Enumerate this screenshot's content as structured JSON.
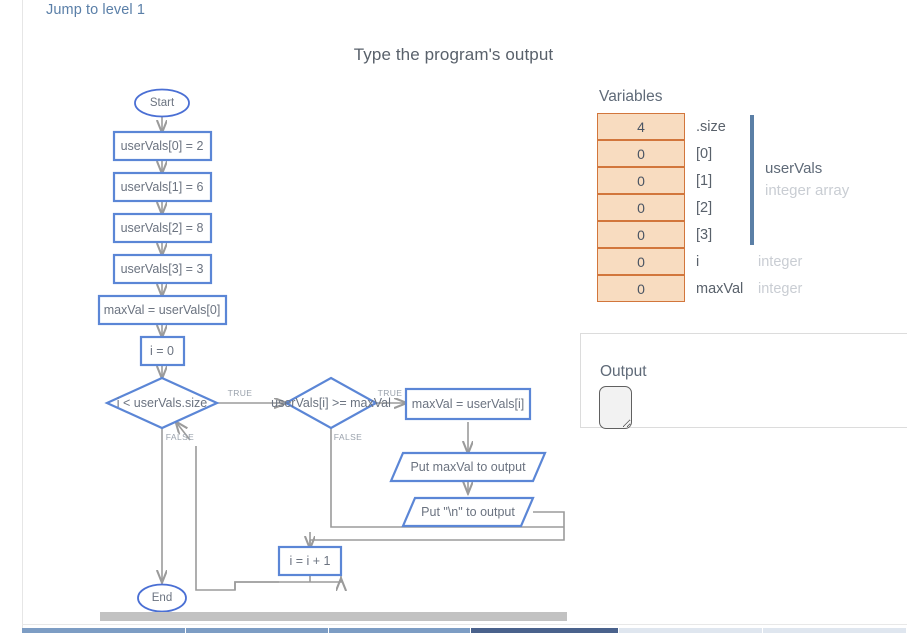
{
  "header": {
    "jump_link": "Jump to level 1",
    "title": "Type the program's output"
  },
  "flowchart": {
    "nodes": [
      {
        "id": "start",
        "type": "terminal",
        "label": "Start"
      },
      {
        "id": "a0",
        "type": "process",
        "label": "userVals[0] = 2"
      },
      {
        "id": "a1",
        "type": "process",
        "label": "userVals[1] = 6"
      },
      {
        "id": "a2",
        "type": "process",
        "label": "userVals[2] = 8"
      },
      {
        "id": "a3",
        "type": "process",
        "label": "userVals[3] = 3"
      },
      {
        "id": "initmax",
        "type": "process",
        "label": "maxVal = userVals[0]"
      },
      {
        "id": "initi",
        "type": "process",
        "label": "i = 0"
      },
      {
        "id": "cond1",
        "type": "decision",
        "label": "i < userVals.size"
      },
      {
        "id": "cond2",
        "type": "decision",
        "label": "userVals[i] >= maxVal"
      },
      {
        "id": "setmax",
        "type": "process",
        "label": "maxVal = userVals[i]"
      },
      {
        "id": "put1",
        "type": "io",
        "label": "Put maxVal to output"
      },
      {
        "id": "put2",
        "type": "io",
        "label": "Put \"\\n\" to output"
      },
      {
        "id": "incr",
        "type": "process",
        "label": "i = i + 1"
      },
      {
        "id": "end",
        "type": "terminal",
        "label": "End"
      }
    ],
    "branch_labels": {
      "cond1_true": "TRUE",
      "cond1_false": "FALSE",
      "cond2_true": "TRUE",
      "cond2_false": "FALSE"
    },
    "colors": {
      "node_border": "#5b86d6",
      "connector": "#9b9b9b",
      "text": "#6b7380"
    }
  },
  "variables": {
    "heading": "Variables",
    "rows": [
      {
        "value": "4",
        "name": ".size",
        "type": ""
      },
      {
        "value": "0",
        "name": "[0]",
        "type": ""
      },
      {
        "value": "0",
        "name": "[1]",
        "type": ""
      },
      {
        "value": "0",
        "name": "[2]",
        "type": ""
      },
      {
        "value": "0",
        "name": "[3]",
        "type": ""
      },
      {
        "value": "0",
        "name": "i",
        "type": "integer"
      },
      {
        "value": "0",
        "name": "maxVal",
        "type": "integer"
      }
    ],
    "array_group": {
      "name": "userVals",
      "type": "integer array"
    },
    "colors": {
      "cell_fill": "#f8dcc0",
      "cell_border": "#d2763c",
      "bracket": "#5b7fa6"
    }
  },
  "output": {
    "label": "Output",
    "value": "",
    "placeholder": ""
  },
  "progress": {
    "segments": [
      {
        "state": "done"
      },
      {
        "state": "done"
      },
      {
        "state": "done"
      },
      {
        "state": "current"
      },
      {
        "state": "pending"
      },
      {
        "state": "pending"
      }
    ]
  }
}
